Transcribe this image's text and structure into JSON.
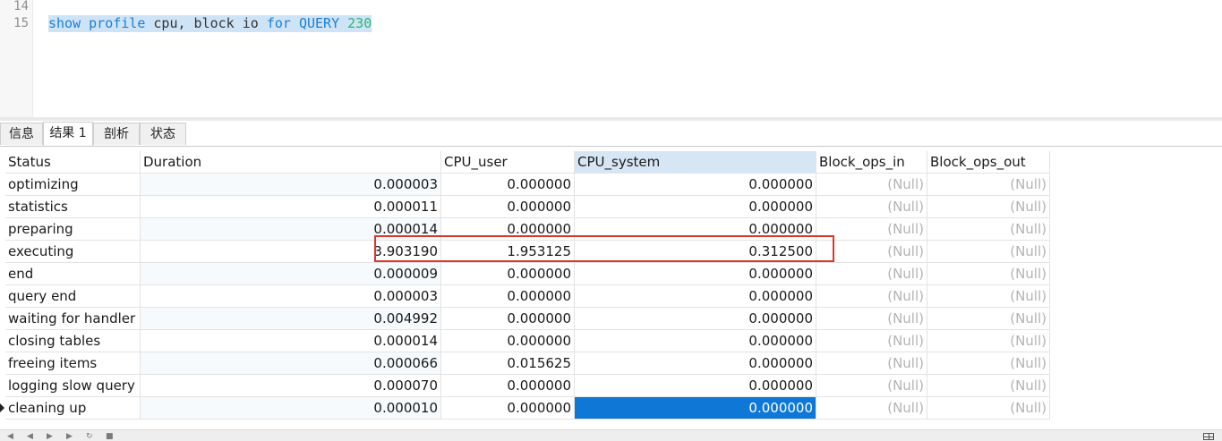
{
  "editor": {
    "line_numbers": [
      "14",
      "15"
    ],
    "query_tokens": [
      {
        "text": "show profile",
        "kind": "kw"
      },
      {
        "text": " cpu, block io ",
        "kind": "id"
      },
      {
        "text": "for QUERY",
        "kind": "kw"
      },
      {
        "text": " ",
        "kind": "id"
      },
      {
        "text": "230",
        "kind": "num"
      }
    ]
  },
  "tabs": [
    {
      "label": "信息",
      "active": false
    },
    {
      "label": "结果 1",
      "active": true
    },
    {
      "label": "剖析",
      "active": false
    },
    {
      "label": "状态",
      "active": false
    }
  ],
  "table": {
    "columns": [
      "Status",
      "Duration",
      "CPU_user",
      "CPU_system",
      "Block_ops_in",
      "Block_ops_out"
    ],
    "selected_column": "CPU_system",
    "rows": [
      [
        "optimizing",
        "0.000003",
        "0.000000",
        "0.000000",
        "(Null)",
        "(Null)"
      ],
      [
        "statistics",
        "0.000011",
        "0.000000",
        "0.000000",
        "(Null)",
        "(Null)"
      ],
      [
        "preparing",
        "0.000014",
        "0.000000",
        "0.000000",
        "(Null)",
        "(Null)"
      ],
      [
        "executing",
        "3.903190",
        "1.953125",
        "0.312500",
        "(Null)",
        "(Null)"
      ],
      [
        "end",
        "0.000009",
        "0.000000",
        "0.000000",
        "(Null)",
        "(Null)"
      ],
      [
        "query end",
        "0.000003",
        "0.000000",
        "0.000000",
        "(Null)",
        "(Null)"
      ],
      [
        "waiting for handler c",
        "0.004992",
        "0.000000",
        "0.000000",
        "(Null)",
        "(Null)"
      ],
      [
        "closing tables",
        "0.000014",
        "0.000000",
        "0.000000",
        "(Null)",
        "(Null)"
      ],
      [
        "freeing items",
        "0.000066",
        "0.015625",
        "0.000000",
        "(Null)",
        "(Null)"
      ],
      [
        "logging slow query",
        "0.000070",
        "0.000000",
        "0.000000",
        "(Null)",
        "(Null)"
      ],
      [
        "cleaning up",
        "0.000010",
        "0.000000",
        "0.000000",
        "(Null)",
        "(Null)"
      ]
    ],
    "highlighted_row": "executing",
    "current_row": "cleaning up",
    "selected_cell": "CPU_system of cleaning up"
  },
  "colors": {
    "keyword": "#1a7fd4",
    "number": "#2bb673",
    "selection": "#0f78d7",
    "highlight_box": "#d9362c",
    "null_text": "#b3b3b3"
  }
}
